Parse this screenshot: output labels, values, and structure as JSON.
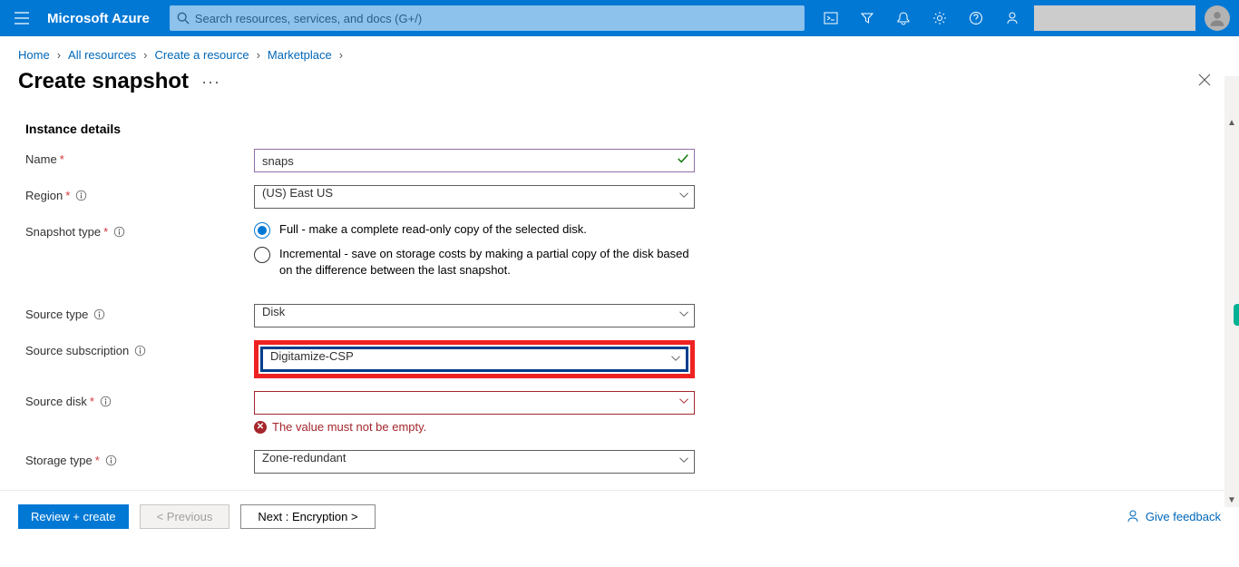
{
  "brand": "Microsoft Azure",
  "search_placeholder": "Search resources, services, and docs (G+/)",
  "breadcrumb": [
    "Home",
    "All resources",
    "Create a resource",
    "Marketplace"
  ],
  "page_title": "Create snapshot",
  "section_title": "Instance details",
  "labels": {
    "name": "Name",
    "region": "Region",
    "snapshot_type": "Snapshot type",
    "source_type": "Source type",
    "source_subscription": "Source subscription",
    "source_disk": "Source disk",
    "storage_type": "Storage type"
  },
  "values": {
    "name": "snaps",
    "region": "(US) East US",
    "source_type": "Disk",
    "source_subscription": "Digitamize-CSP",
    "source_disk": "",
    "storage_type": "Zone-redundant"
  },
  "radios": {
    "full": "Full - make a complete read-only copy of the selected disk.",
    "incremental": "Incremental - save on storage costs by making a partial copy of the disk based on the difference between the last snapshot."
  },
  "error_msg": "The value must not be empty.",
  "buttons": {
    "review": "Review + create",
    "prev": "< Previous",
    "next": "Next : Encryption >",
    "feedback": "Give feedback"
  }
}
